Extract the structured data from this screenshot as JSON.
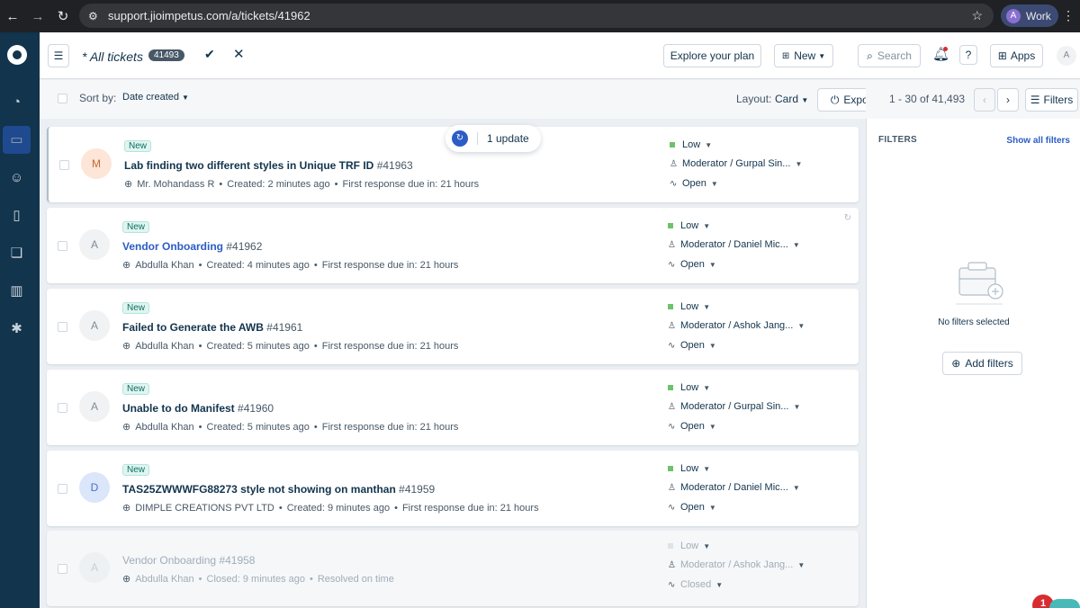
{
  "browser": {
    "url": "support.jioimpetus.com/a/tickets/41962",
    "profile_initial": "A",
    "profile_label": "Work"
  },
  "header": {
    "view_title": "* All tickets",
    "ticket_count": "41493",
    "explore_label": "Explore your plan",
    "new_label": "New",
    "search_placeholder": "Search",
    "apps_label": "Apps",
    "user_initial": "A"
  },
  "sortbar": {
    "sort_by_label": "Sort by:",
    "sort_value": "Date created",
    "layout_label": "Layout:",
    "layout_value": "Card",
    "export_label": "Export",
    "pagination": "1 - 30 of 41,493",
    "filters_label": "Filters"
  },
  "update_pill": {
    "label": "1 update"
  },
  "tickets": [
    {
      "avatar": "M",
      "avatar_bg": "#fde5d7",
      "avatar_fg": "#c2693a",
      "tag": "New",
      "subject": "Lab finding two different styles in Unique TRF ID",
      "number": "#41963",
      "requester": "Mr. Mohandass R",
      "created": "Created: 2 minutes ago",
      "response": "First response due in: 21 hours",
      "priority": "Low",
      "group": "Moderator / Gurpal Sin...",
      "status": "Open"
    },
    {
      "avatar": "A",
      "avatar_bg": "#f0f2f4",
      "avatar_fg": "#7f8c98",
      "tag": "New",
      "subject": "Vendor Onboarding",
      "number": "#41962",
      "requester": "Abdulla Khan",
      "created": "Created: 4 minutes ago",
      "response": "First response due in: 21 hours",
      "priority": "Low",
      "group": "Moderator / Daniel Mic...",
      "status": "Open"
    },
    {
      "avatar": "A",
      "avatar_bg": "#f0f2f4",
      "avatar_fg": "#7f8c98",
      "tag": "New",
      "subject": "Failed to Generate the AWB",
      "number": "#41961",
      "requester": "Abdulla Khan",
      "created": "Created: 5 minutes ago",
      "response": "First response due in: 21 hours",
      "priority": "Low",
      "group": "Moderator / Ashok Jang...",
      "status": "Open"
    },
    {
      "avatar": "A",
      "avatar_bg": "#f0f2f4",
      "avatar_fg": "#7f8c98",
      "tag": "New",
      "subject": "Unable to do Manifest",
      "number": "#41960",
      "requester": "Abdulla Khan",
      "created": "Created: 5 minutes ago",
      "response": "First response due in: 21 hours",
      "priority": "Low",
      "group": "Moderator / Gurpal Sin...",
      "status": "Open"
    },
    {
      "avatar": "D",
      "avatar_bg": "#dbe6fb",
      "avatar_fg": "#4a6fc7",
      "tag": "New",
      "subject": "TAS25ZWWWFG88273 style not showing on manthan",
      "number": "#41959",
      "requester": "DIMPLE CREATIONS PVT LTD",
      "created": "Created: 9 minutes ago",
      "response": "First response due in: 21 hours",
      "priority": "Low",
      "group": "Moderator / Daniel Mic...",
      "status": "Open"
    },
    {
      "avatar": "A",
      "avatar_bg": "#eef1f4",
      "avatar_fg": "#c7cfd6",
      "tag": "",
      "subject": "Vendor Onboarding",
      "number": "#41958",
      "requester": "Abdulla Khan",
      "created": "Closed: 9 minutes ago",
      "response": "Resolved on time",
      "priority": "Low",
      "group": "Moderator / Ashok Jang...",
      "status": "Closed"
    }
  ],
  "filters_panel": {
    "heading": "FILTERS",
    "show_all": "Show all filters",
    "empty_text": "No filters selected",
    "add_label": "Add filters"
  },
  "notification_count": "1",
  "colors": {
    "nav_bg": "#12344d",
    "accent": "#2c5cc5",
    "priority_low": "#6dc36d"
  }
}
